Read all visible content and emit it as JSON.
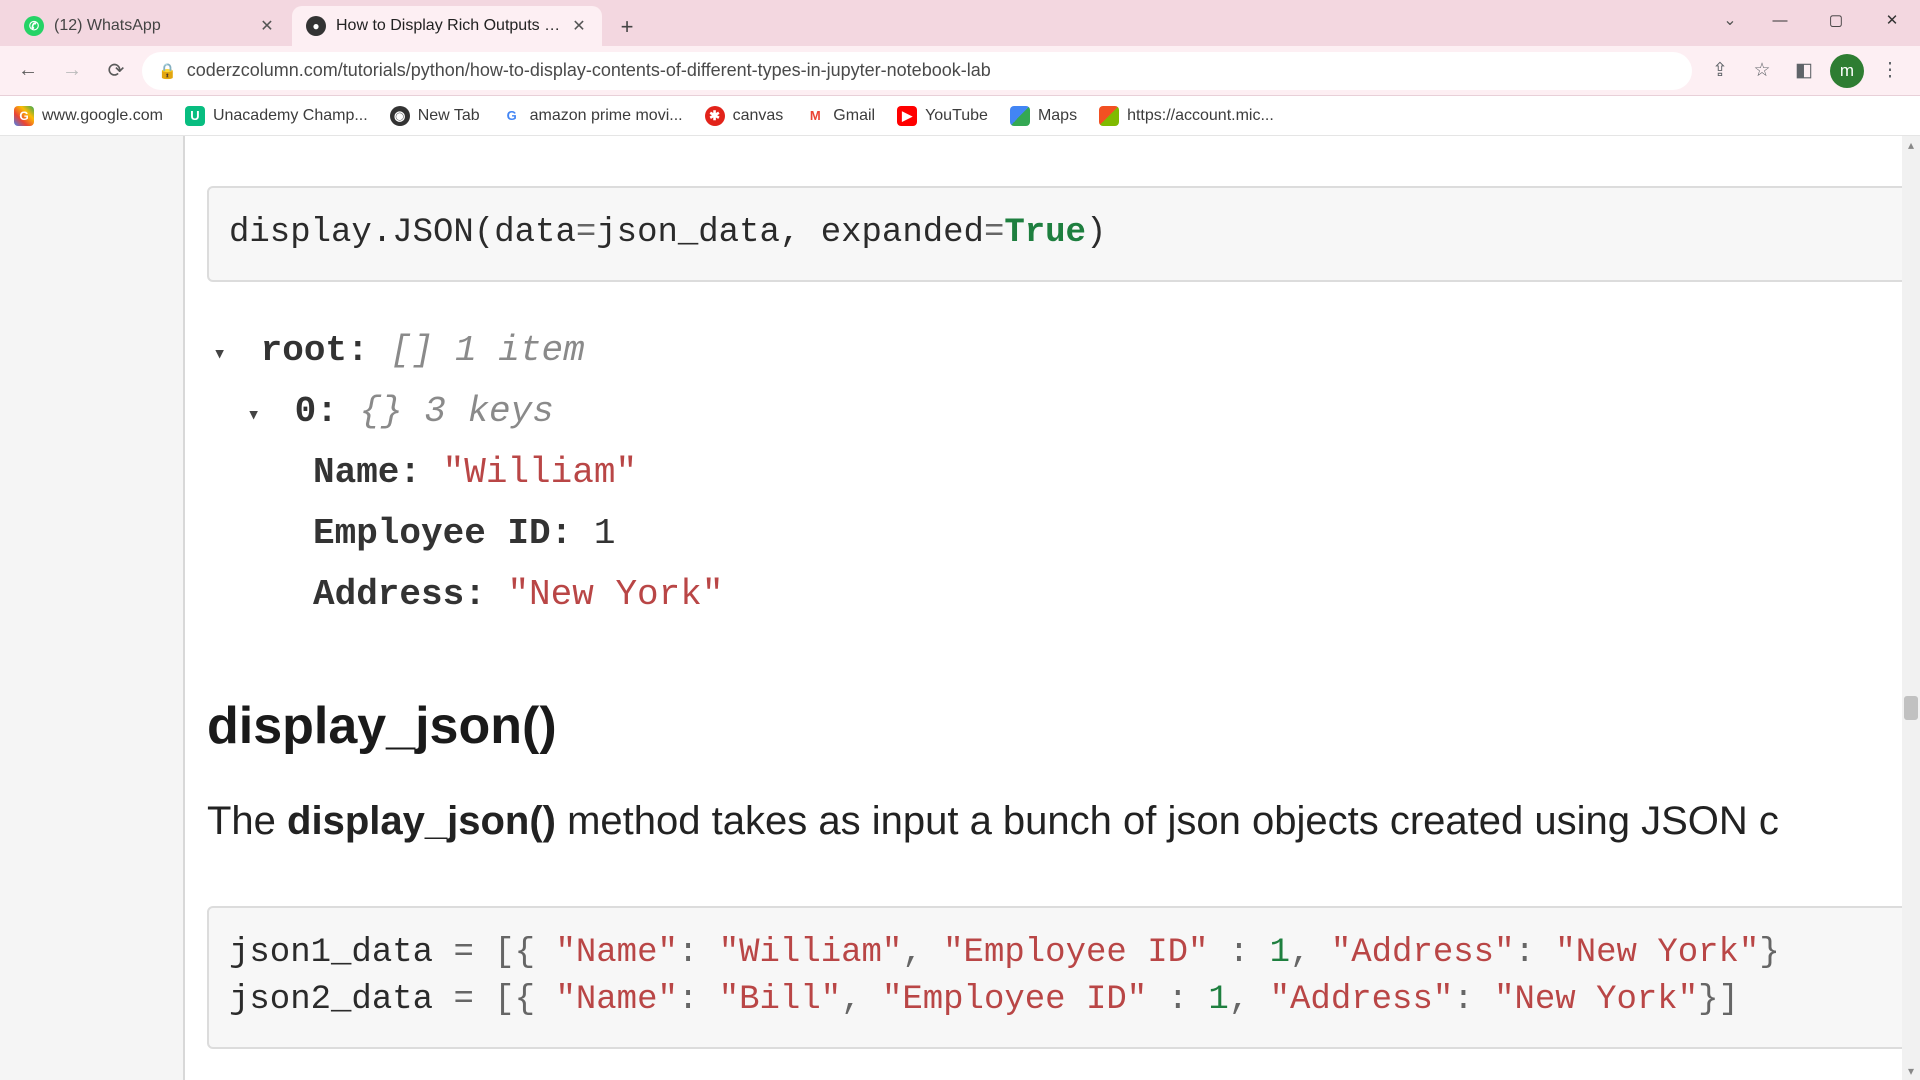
{
  "tabs": [
    {
      "title": "(12) WhatsApp",
      "favicon": "whatsapp"
    },
    {
      "title": "How to Display Rich Outputs (im",
      "favicon": "site"
    }
  ],
  "toolbar": {
    "url": "coderzcolumn.com/tutorials/python/how-to-display-contents-of-different-types-in-jupyter-notebook-lab",
    "avatar_initial": "m"
  },
  "bookmarks": [
    {
      "label": "www.google.com",
      "icon": "google"
    },
    {
      "label": "Unacademy Champ...",
      "icon": "unacademy"
    },
    {
      "label": "New Tab",
      "icon": "newtab"
    },
    {
      "label": "amazon prime movi...",
      "icon": "amazon"
    },
    {
      "label": "canvas",
      "icon": "canvas"
    },
    {
      "label": "Gmail",
      "icon": "gmail"
    },
    {
      "label": "YouTube",
      "icon": "youtube"
    },
    {
      "label": "Maps",
      "icon": "maps"
    },
    {
      "label": "https://account.mic...",
      "icon": "ms"
    }
  ],
  "code1": {
    "p1": "display.JSON(data",
    "p2": "=",
    "p3": "json_data, expanded",
    "p4": "=",
    "p5": "True",
    "p6": ")"
  },
  "json_tree": {
    "root_key": "root:",
    "root_meta": "[] 1 item",
    "idx_key": "0:",
    "idx_meta": "{} 3 keys",
    "k1": "Name:",
    "v1": "\"William\"",
    "k2": "Employee ID:",
    "v2": "1",
    "k3": "Address:",
    "v3": "\"New York\""
  },
  "heading": "display_json()",
  "para": {
    "pre": "The ",
    "bold": "display_json()",
    "post": " method takes as input a bunch of json objects created using JSON c"
  },
  "code2": {
    "l1_var": "json1_data ",
    "l1_eq": "= [{ ",
    "l1_k1": "\"Name\"",
    "l1_c1": ": ",
    "l1_v1": "\"William\"",
    "l1_c2": ", ",
    "l1_k2": "\"Employee ID\"",
    "l1_c3": " : ",
    "l1_v2": "1",
    "l1_c4": ", ",
    "l1_k3": "\"Address\"",
    "l1_c5": ": ",
    "l1_v3": "\"New York\"",
    "l1_end": "}",
    "l2_var": "json2_data ",
    "l2_eq": "= [{ ",
    "l2_k1": "\"Name\"",
    "l2_c1": ": ",
    "l2_v1": "\"Bill\"",
    "l2_c2": ", ",
    "l2_k2": "\"Employee ID\"",
    "l2_c3": " : ",
    "l2_v2": "1",
    "l2_c4": ", ",
    "l2_k3": "\"Address\"",
    "l2_c5": ": ",
    "l2_v3": "\"New York\"",
    "l2_end": "}]"
  }
}
